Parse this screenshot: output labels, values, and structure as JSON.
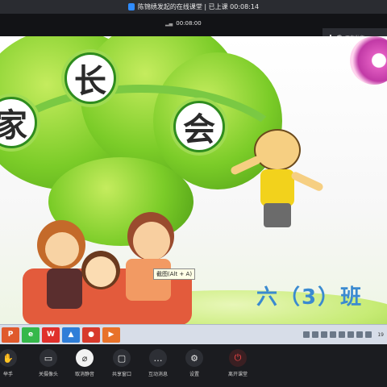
{
  "meeting": {
    "banner_title": "陈锦绣发起的在线课堂 | 已上课 00:08:14",
    "timer": "00:08:00",
    "status_text": "正在发言",
    "status_icon": "audio-bars-icon"
  },
  "slide": {
    "chars": [
      "家",
      "长",
      "会"
    ],
    "class_label": "六（3）班",
    "tooltip": "截图(Alt + A)"
  },
  "taskbar": {
    "apps": [
      {
        "icon": "ppt-icon",
        "color": "#e05a2c"
      },
      {
        "icon": "browser-green-icon",
        "color": "#35b84a"
      },
      {
        "icon": "wps-icon",
        "color": "#e0302c"
      },
      {
        "icon": "recycle-icon",
        "color": "#2f7ed8"
      },
      {
        "icon": "app-red-icon",
        "color": "#d83a2c"
      },
      {
        "icon": "video-app-icon",
        "color": "#e8722a"
      }
    ],
    "clock": "19"
  },
  "controls": [
    {
      "name": "raise-hand",
      "label": "举手",
      "icon": "hand-icon",
      "style": "dark"
    },
    {
      "name": "camera",
      "label": "关摄像头",
      "icon": "camera-icon",
      "style": "dark"
    },
    {
      "name": "mute",
      "label": "取消静音",
      "icon": "mic-off-icon",
      "style": "white"
    },
    {
      "name": "share-window",
      "label": "共享窗口",
      "icon": "screen-share-icon",
      "style": "dark"
    },
    {
      "name": "interaction",
      "label": "互动消息",
      "icon": "chat-icon",
      "style": "dark"
    },
    {
      "name": "settings",
      "label": "设置",
      "icon": "gear-icon",
      "style": "dark"
    },
    {
      "name": "leave",
      "label": "离开课堂",
      "icon": "power-icon",
      "style": "red"
    }
  ]
}
